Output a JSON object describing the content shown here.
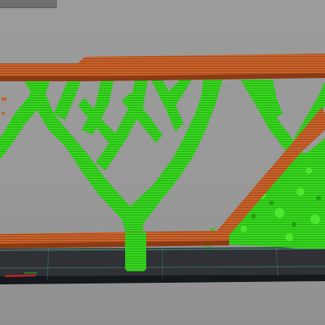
{
  "viewport": {
    "label": "",
    "colors": {
      "background": "#9a9a9a",
      "bed": "#2f3136",
      "bed_edge": "#111418",
      "bed_grid": "#55d0a0",
      "axis_red": "#d62020",
      "model_orange": "#c8622a",
      "model_orange_dark": "#8c3a14",
      "support_green": "#36d61e",
      "support_green_dark": "#1f8f10",
      "support_green_light": "#55ef33",
      "panel_tab": "#6f6f6f"
    },
    "icons": [
      "axis-marker-icon"
    ]
  }
}
